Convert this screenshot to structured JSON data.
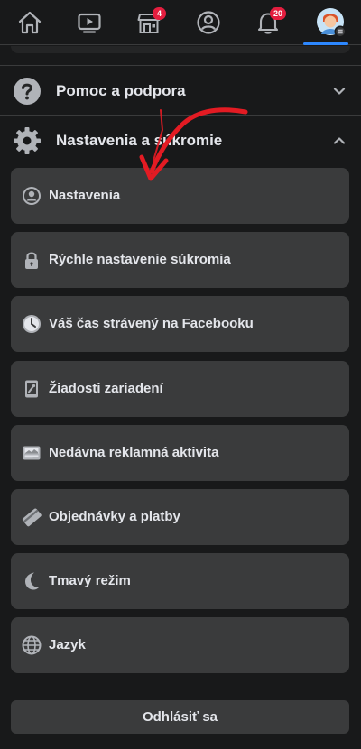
{
  "nav": {
    "items": [
      {
        "icon": "home-icon"
      },
      {
        "icon": "watch-icon"
      },
      {
        "icon": "marketplace-icon",
        "badge": "4"
      },
      {
        "icon": "profile-icon"
      },
      {
        "icon": "notifications-icon",
        "badge": "20"
      },
      {
        "icon": "menu-avatar-icon",
        "active": true
      }
    ],
    "accent_color": "#2d88ff",
    "badge_color": "#e41e3f"
  },
  "sections": [
    {
      "label": "Pomoc a podpora",
      "icon": "help-icon",
      "expanded": false
    },
    {
      "label": "Nastavenia a súkromie",
      "icon": "gear-icon",
      "expanded": true
    }
  ],
  "settings_items": [
    {
      "label": "Nastavenia",
      "icon": "user-circle-icon"
    },
    {
      "label": "Rýchle nastavenie súkromia",
      "icon": "lock-icon"
    },
    {
      "label": "Váš čas strávený na Facebooku",
      "icon": "clock-icon"
    },
    {
      "label": "Žiadosti zariadení",
      "icon": "device-icon"
    },
    {
      "label": "Nedávna reklamná aktivita",
      "icon": "ad-activity-icon"
    },
    {
      "label": "Objednávky a platby",
      "icon": "card-icon"
    },
    {
      "label": "Tmavý režim",
      "icon": "moon-icon"
    },
    {
      "label": "Jazyk",
      "icon": "globe-icon"
    }
  ],
  "logout_label": "Odhlásiť sa",
  "annotation": {
    "type": "arrow",
    "color": "#e31b23"
  }
}
